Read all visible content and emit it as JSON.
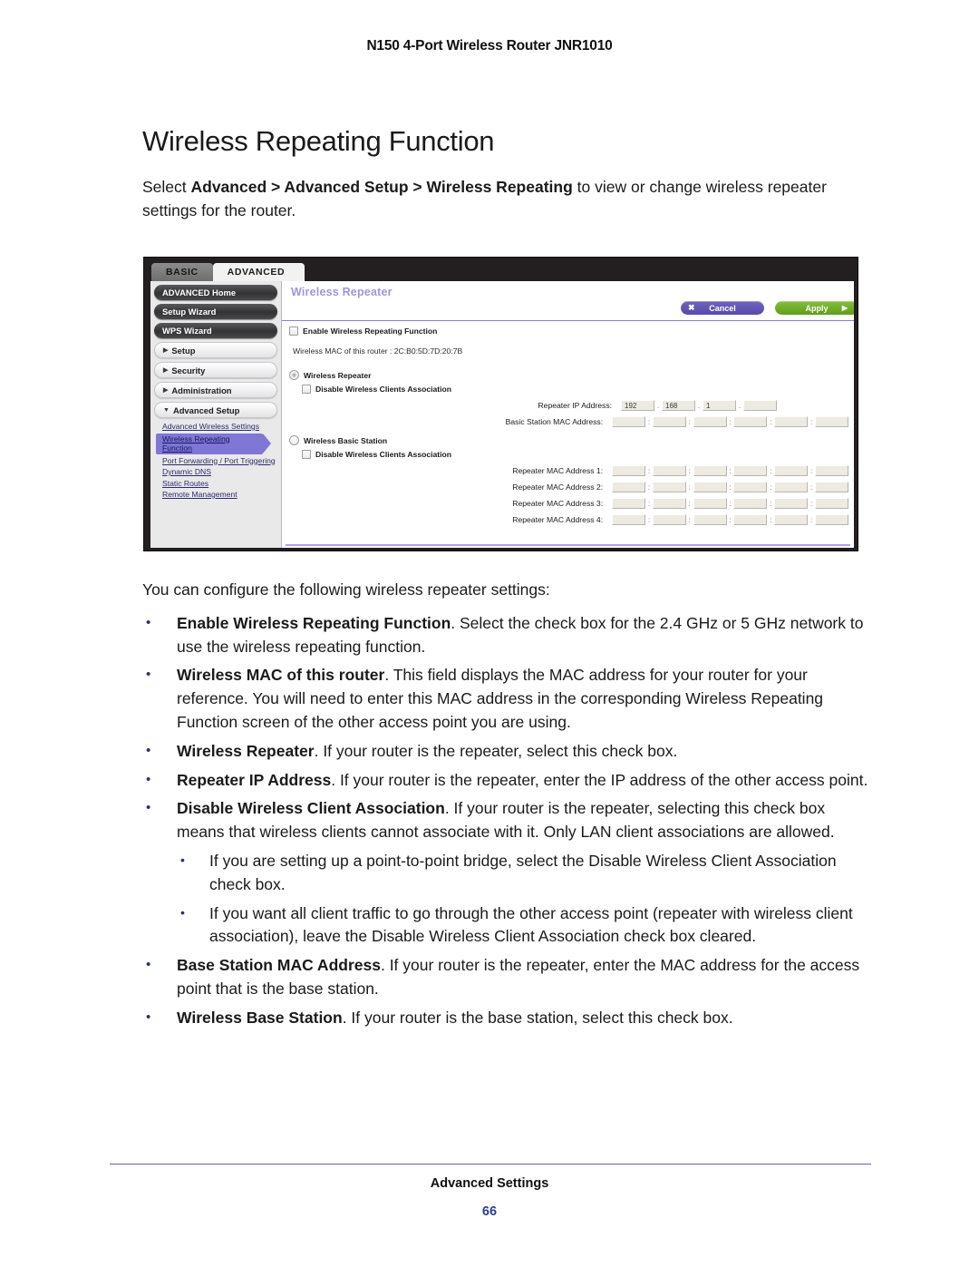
{
  "document": {
    "running_header": "N150 4-Port Wireless Router JNR1010",
    "page_title": "Wireless Repeating Function",
    "intro": {
      "prefix": "Select ",
      "path": "Advanced > Advanced Setup > Wireless Repeating",
      "suffix": " to view or change wireless repeater settings for the router."
    },
    "lead": "You can configure the following wireless repeater settings:",
    "footer_title": "Advanced Settings",
    "footer_page": "66"
  },
  "bullets": [
    {
      "term": "Enable Wireless Repeating Function",
      "text": ". Select the check box for the 2.4 GHz or 5 GHz network to use the wireless repeating function."
    },
    {
      "term": "Wireless MAC of this router",
      "text": ". This field displays the MAC address for your router for your reference. You will need to enter this MAC address in the corresponding Wireless Repeating Function screen of the other access point you are using."
    },
    {
      "term": "Wireless Repeater",
      "text": ". If your router is the repeater, select this check box."
    },
    {
      "term": "Repeater IP Address",
      "text": ". If your router is the repeater, enter the IP address of the other access point."
    },
    {
      "term": "Disable Wireless Client Association",
      "text": ". If your router is the repeater, selecting this check box means that wireless clients cannot associate with it. Only LAN client associations are allowed."
    },
    {
      "term": "Base Station MAC Address",
      "text": ". If your router is the repeater, enter the MAC address for the access point that is the base station."
    },
    {
      "term": "Wireless Base Station",
      "text": ". If your router is the base station, select this check box."
    }
  ],
  "sub_bullets": [
    "If you are setting up a point-to-point bridge, select the Disable Wireless Client Association check box.",
    "If you want all client traffic to go through the other access point (repeater with wireless client association), leave the Disable Wireless Client Association check box cleared."
  ],
  "screenshot": {
    "tabs": [
      {
        "label": "BASIC",
        "active": false
      },
      {
        "label": "ADVANCED",
        "active": true
      }
    ],
    "nav": {
      "buttons": [
        {
          "label": "ADVANCED Home",
          "style": "dark"
        },
        {
          "label": "Setup Wizard",
          "style": "dark"
        },
        {
          "label": "WPS Wizard",
          "style": "dark"
        }
      ],
      "sections": [
        {
          "label": "Setup",
          "arrow": "▶",
          "expanded": false
        },
        {
          "label": "Security",
          "arrow": "▶",
          "expanded": false
        },
        {
          "label": "Administration",
          "arrow": "▶",
          "expanded": false
        },
        {
          "label": "Advanced Setup",
          "arrow": "▼",
          "expanded": true
        }
      ],
      "sublinks": [
        {
          "label": "Advanced Wireless Settings",
          "selected": false
        },
        {
          "label": "Wireless Repeating Function",
          "selected": true
        },
        {
          "label": "Port Forwarding / Port Triggering",
          "selected": false
        },
        {
          "label": "Dynamic DNS",
          "selected": false
        },
        {
          "label": "Static Routes",
          "selected": false
        },
        {
          "label": "Remote Management",
          "selected": false
        }
      ]
    },
    "panel": {
      "title": "Wireless Repeater",
      "cancel_label": "Cancel",
      "cancel_glyph": "✖",
      "apply_label": "Apply",
      "apply_glyph": "▶",
      "enable_label": "Enable Wireless Repeating Function",
      "enable_checked": false,
      "mac_line": "Wireless MAC of this router : 2C:B0:5D:7D:20:7B",
      "repeater_radio_label": "Wireless Repeater",
      "repeater_radio_selected": true,
      "repeater_disable_label": "Disable Wireless Clients Association",
      "base_radio_label": "Wireless Basic Station",
      "base_radio_selected": false,
      "base_disable_label": "Disable Wireless Clients Association",
      "repeater_ip_label": "Repeater IP Address:",
      "repeater_ip_values": [
        "192",
        "168",
        "1",
        ""
      ],
      "basic_station_mac_label": "Basic Station MAC Address:",
      "basic_station_mac_values": [
        "",
        "",
        "",
        "",
        "",
        ""
      ],
      "repeater_mac_rows": [
        {
          "label": "Repeater MAC Address 1:",
          "values": [
            "",
            "",
            "",
            "",
            "",
            ""
          ]
        },
        {
          "label": "Repeater MAC Address 2:",
          "values": [
            "",
            "",
            "",
            "",
            "",
            ""
          ]
        },
        {
          "label": "Repeater MAC Address 3:",
          "values": [
            "",
            "",
            "",
            "",
            "",
            ""
          ]
        },
        {
          "label": "Repeater MAC Address 4:",
          "values": [
            "",
            "",
            "",
            "",
            "",
            ""
          ]
        }
      ]
    },
    "colors": {
      "chrome": "#231f20",
      "accent_purple": "#7f76d6",
      "title_purple": "#9f95e0",
      "apply_green": "#6fae28",
      "cancel_purple": "#6257b4"
    }
  }
}
